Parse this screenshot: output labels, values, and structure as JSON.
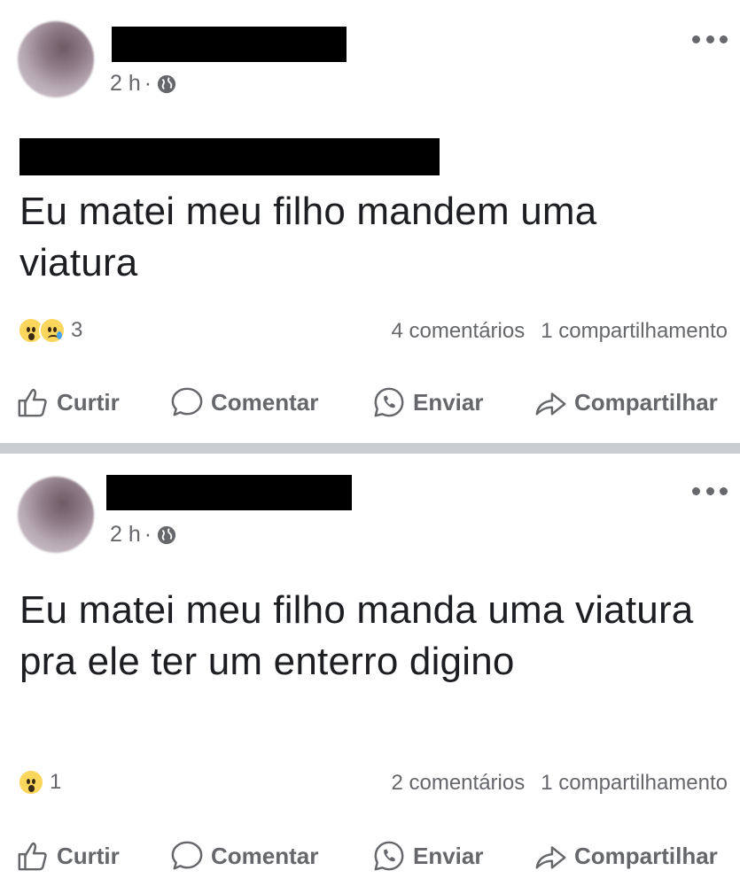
{
  "posts": [
    {
      "timestamp": "2 h",
      "separator": "·",
      "text": "Eu matei meu filho mandem uma viatura",
      "reaction_count": "3",
      "reactions": [
        "wow-emoji",
        "sad-emoji"
      ],
      "comments": "4 comentários",
      "shares": "1 compartilhamento"
    },
    {
      "timestamp": "2 h",
      "separator": "·",
      "text": "Eu matei meu filho manda uma viatura pra ele ter um enterro digino",
      "reaction_count": "1",
      "reactions": [
        "wow-emoji"
      ],
      "comments": "2 comentários",
      "shares": "1 compartilhamento"
    }
  ],
  "actions": {
    "like": "Curtir",
    "comment": "Comentar",
    "send": "Enviar",
    "share": "Compartilhar"
  },
  "colors": {
    "secondary_text": "#65676b",
    "primary_text": "#1c1e21",
    "divider": "#c9ccd1",
    "redaction": "#000000"
  }
}
